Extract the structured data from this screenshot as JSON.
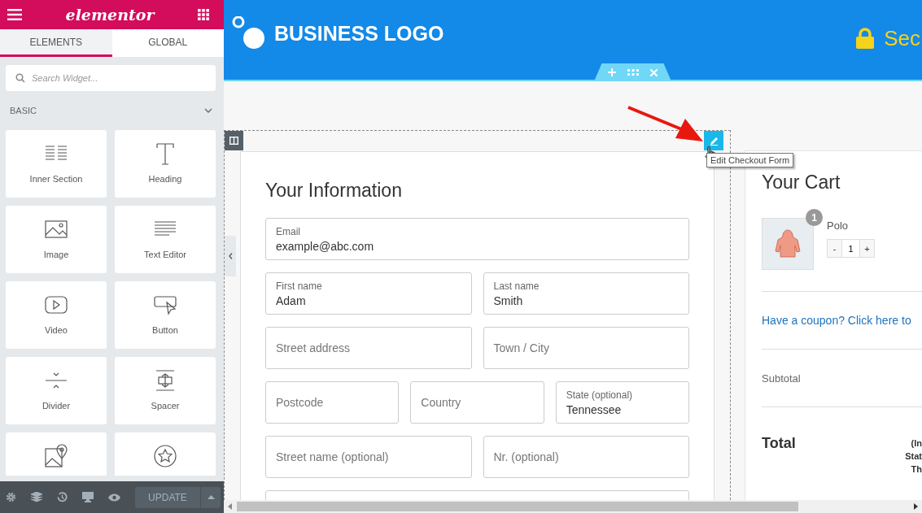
{
  "sidebar": {
    "logo": "elementor",
    "tabs": [
      {
        "label": "ELEMENTS",
        "selected": true
      },
      {
        "label": "GLOBAL",
        "selected": false
      }
    ],
    "search": {
      "placeholder": "Search Widget..."
    },
    "category": {
      "label": "BASIC",
      "expanded": true
    },
    "widgets": [
      {
        "kind": "inner-section",
        "label": "Inner Section"
      },
      {
        "kind": "heading",
        "label": "Heading"
      },
      {
        "kind": "image",
        "label": "Image"
      },
      {
        "kind": "text-editor",
        "label": "Text Editor"
      },
      {
        "kind": "video",
        "label": "Video"
      },
      {
        "kind": "button",
        "label": "Button"
      },
      {
        "kind": "divider",
        "label": "Divider"
      },
      {
        "kind": "spacer",
        "label": "Spacer"
      },
      {
        "kind": "map"
      },
      {
        "kind": "star"
      }
    ],
    "footer": {
      "update_button": "UPDATE"
    }
  },
  "header": {
    "logo_text": "BUSINESS LOGO",
    "secure_text": "Sec"
  },
  "tooltip": "Edit Checkout Form",
  "form": {
    "title": "Your Information",
    "rows": [
      [
        {
          "label": "Email",
          "value": "example@abc.com"
        }
      ],
      [
        {
          "label": "First name",
          "value": "Adam"
        },
        {
          "label": "Last name",
          "value": "Smith"
        }
      ],
      [
        {
          "placeholder": "Street address"
        },
        {
          "placeholder": "Town / City"
        }
      ],
      [
        {
          "placeholder": "Postcode"
        },
        {
          "placeholder": "Country"
        },
        {
          "label": "State (optional)",
          "value": "Tennessee"
        }
      ],
      [
        {
          "placeholder": "Street name (optional)"
        },
        {
          "placeholder": "Nr. (optional)"
        }
      ],
      [
        {}
      ]
    ]
  },
  "cart": {
    "title": "Your Cart",
    "item": {
      "name": "Polo",
      "badge": "1",
      "quantity": "1",
      "minus": "-",
      "plus": "+"
    },
    "coupon_link": "Have a coupon? Click here to",
    "subtotal_label": "Subtotal",
    "total_label": "Total",
    "total_note": [
      "(In",
      "Stat",
      "Th"
    ]
  }
}
